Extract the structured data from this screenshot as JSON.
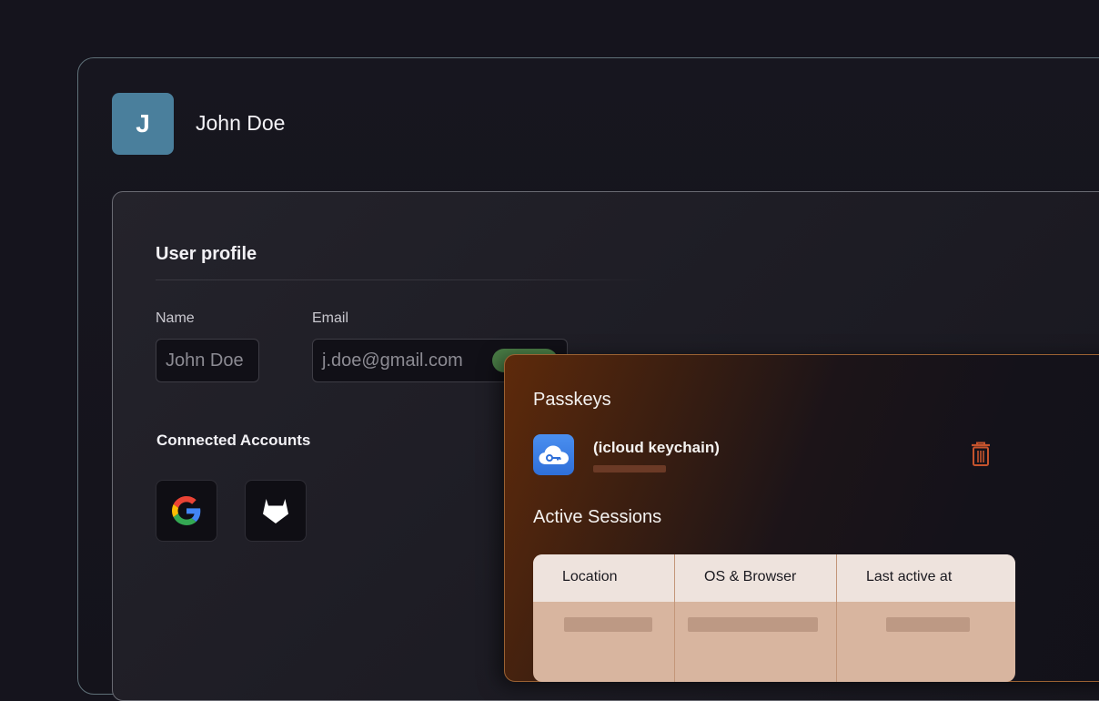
{
  "user": {
    "avatar_initial": "J",
    "name": "John Doe"
  },
  "profile": {
    "section_title": "User profile",
    "name_label": "Name",
    "name_value": "John Doe",
    "email_label": "Email",
    "email_value": "j.doe@gmail.com",
    "email_status_color": "#4a7d46"
  },
  "connected_accounts": {
    "title": "Connected Accounts",
    "accounts": [
      {
        "icon": "google-icon"
      },
      {
        "icon": "gitlab-icon"
      }
    ]
  },
  "passkeys": {
    "title": "Passkeys",
    "items": [
      {
        "icon": "cloud-key-icon",
        "name": "(icloud keychain)"
      }
    ],
    "delete_icon": "trash-icon",
    "accent_color": "#c5532d"
  },
  "sessions": {
    "title": "Active Sessions",
    "columns": [
      "Location",
      "OS & Browser",
      "Last active at"
    ]
  },
  "colors": {
    "background": "#15141d",
    "avatar": "#4a7f9c",
    "panel_accent": "#9b6233",
    "table_header": "#eee3dd",
    "table_body": "#d8b59f"
  }
}
